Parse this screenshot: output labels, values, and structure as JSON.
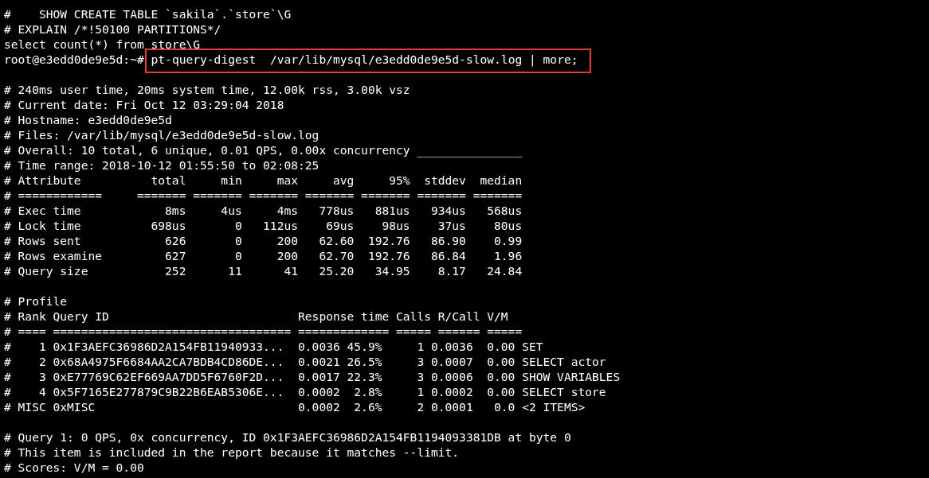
{
  "terminal": {
    "lines": [
      {
        "kind": "text",
        "text": "#    SHOW CREATE TABLE `sakila`.`store`\\G"
      },
      {
        "kind": "text",
        "text": "# EXPLAIN /*!50100 PARTITIONS*/"
      },
      {
        "kind": "text",
        "text": "select count(*) from store\\G"
      },
      {
        "kind": "command",
        "prompt": "root@e3edd0de9e5d:~#",
        "command": "pt-query-digest  /var/lib/mysql/e3edd0de9e5d-slow.log | more;",
        "highlighted": true
      },
      {
        "kind": "blank"
      },
      {
        "kind": "text",
        "text": "# 240ms user time, 20ms system time, 12.00k rss, 3.00k vsz"
      },
      {
        "kind": "text",
        "text": "# Current date: Fri Oct 12 03:29:04 2018"
      },
      {
        "kind": "text",
        "text": "# Hostname: e3edd0de9e5d"
      },
      {
        "kind": "text",
        "text": "# Files: /var/lib/mysql/e3edd0de9e5d-slow.log"
      },
      {
        "kind": "text",
        "text": "# Overall: 10 total, 6 unique, 0.01 QPS, 0.00x concurrency _______________"
      },
      {
        "kind": "text",
        "text": "# Time range: 2018-10-12 01:55:50 to 02:08:25"
      },
      {
        "kind": "text",
        "text": "# Attribute          total     min     max     avg     95%  stddev  median"
      },
      {
        "kind": "text",
        "text": "# ============     ======= ======= ======= ======= ======= ======= ======="
      },
      {
        "kind": "text",
        "text": "# Exec time            8ms     4us     4ms   778us   881us   934us   568us"
      },
      {
        "kind": "text",
        "text": "# Lock time          698us       0   112us    69us    98us    37us    80us"
      },
      {
        "kind": "text",
        "text": "# Rows sent            626       0     200   62.60  192.76   86.90    0.99"
      },
      {
        "kind": "text",
        "text": "# Rows examine         627       0     200   62.70  192.76   86.84    1.96"
      },
      {
        "kind": "text",
        "text": "# Query size           252      11      41   25.20   34.95    8.17   24.84"
      },
      {
        "kind": "blank"
      },
      {
        "kind": "text",
        "text": "# Profile"
      },
      {
        "kind": "text",
        "text": "# Rank Query ID                           Response time Calls R/Call V/M"
      },
      {
        "kind": "text",
        "text": "# ==== ================================== ============= ===== ====== ====="
      },
      {
        "kind": "text",
        "text": "#    1 0x1F3AEFC36986D2A154FB11940933...  0.0036 45.9%     1 0.0036  0.00 SET"
      },
      {
        "kind": "text",
        "text": "#    2 0x68A4975F6684AA2CA7BDB4CD86DE...  0.0021 26.5%     3 0.0007  0.00 SELECT actor"
      },
      {
        "kind": "text",
        "text": "#    3 0xE77769C62EF669AA7DD5F6760F2D...  0.0017 22.3%     3 0.0006  0.00 SHOW VARIABLES"
      },
      {
        "kind": "text",
        "text": "#    4 0x5F7165E277879C9B22B6EAB5306E...  0.0002  2.8%     1 0.0002  0.00 SELECT store"
      },
      {
        "kind": "text",
        "text": "# MISC 0xMISC                             0.0002  2.6%     2 0.0001   0.0 <2 ITEMS>"
      },
      {
        "kind": "blank"
      },
      {
        "kind": "text",
        "text": "# Query 1: 0 QPS, 0x concurrency, ID 0x1F3AEFC36986D2A154FB1194093381DB at byte 0"
      },
      {
        "kind": "text",
        "text": "# This item is included in the report because it matches --limit."
      },
      {
        "kind": "text",
        "text": "# Scores: V/M = 0.00"
      }
    ]
  }
}
